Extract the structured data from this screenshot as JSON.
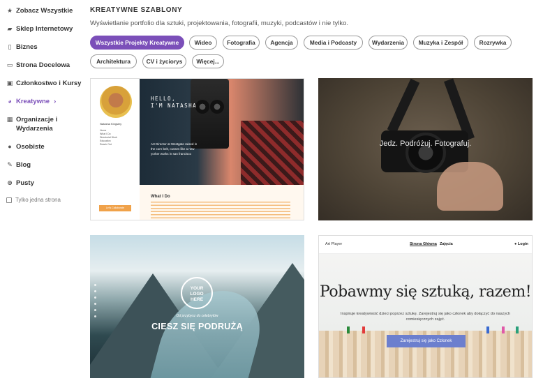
{
  "sidebar": {
    "items": [
      {
        "label": "Zobacz Wszystkie",
        "icon": "star-icon",
        "glyph": "★"
      },
      {
        "label": "Sklep Internetowy",
        "icon": "cart-icon",
        "glyph": "🛒"
      },
      {
        "label": "Biznes",
        "icon": "clipboard-icon",
        "glyph": "📋"
      },
      {
        "label": "Strona Docelowa",
        "icon": "page-icon",
        "glyph": "▭"
      },
      {
        "label": "Członkostwo i Kursy",
        "icon": "id-card-icon",
        "glyph": "▣"
      },
      {
        "label": "Kreatywne",
        "icon": "palette-icon",
        "glyph": "◕",
        "active": true,
        "chevron": "›"
      },
      {
        "label": "Organizacje i Wydarzenia",
        "icon": "calendar-icon",
        "glyph": "▦"
      },
      {
        "label": "Osobiste",
        "icon": "person-icon",
        "glyph": "●"
      },
      {
        "label": "Blog",
        "icon": "pen-icon",
        "glyph": "✎"
      },
      {
        "label": "Pusty",
        "icon": "plus-circle-icon",
        "glyph": "⊕"
      }
    ],
    "single_page_checkbox": "Tylko jedna strona"
  },
  "main": {
    "title": "KREATYWNE SZABLONY",
    "subtitle": "Wyświetlanie portfolio dla sztuki, projektowania, fotografii, muzyki, podcastów i nie tylko.",
    "filters": [
      {
        "label": "Wszystkie Projekty Kreatywne",
        "active": true
      },
      {
        "label": "Wideo"
      },
      {
        "label": "Fotografia"
      },
      {
        "label": "Agencja"
      },
      {
        "label": "Media i Podcasty"
      },
      {
        "label": "Wydarzenia"
      },
      {
        "label": "Muzyka i Zespół"
      },
      {
        "label": "Rozrywka"
      },
      {
        "label": "Architektura"
      },
      {
        "label": "CV i życiorys"
      },
      {
        "label": "Więcej..."
      }
    ]
  },
  "cards": {
    "natasha": {
      "name": "Natasha Kingsley",
      "nav": "Home\nWhat I Do\nDirectorial Work\nEducation\nReach Out",
      "hello": "HELLO,\nI'M NATASHA",
      "hero_text": "Art Director at Westgate raised in the corn belt, cusses like a new yorker works in san francisco",
      "section": "What I Do",
      "cta": "Let's Collaborate"
    },
    "camera": {
      "overlay": "Jedz. Podróżuj. Fotografuj."
    },
    "travel": {
      "logo": "YOUR\nLOGO\nHERE",
      "small": "Od przybysz do celebrytów",
      "big": "CIESZ SIĘ PODRUŻĄ"
    },
    "art": {
      "brand": "Art Player",
      "menu_home": "Strona Główna",
      "menu_classes": "Zajęcia",
      "login": "Login",
      "headline": "Pobawmy się sztuką, razem!",
      "description": "Inspiruje kreatywność dzieci poprzez sztukę. Zarejestruj się jako członek aby dołączyć do naszych comiesięcznych zajęć.",
      "button": "Zarejestruj się jako Członek"
    }
  }
}
